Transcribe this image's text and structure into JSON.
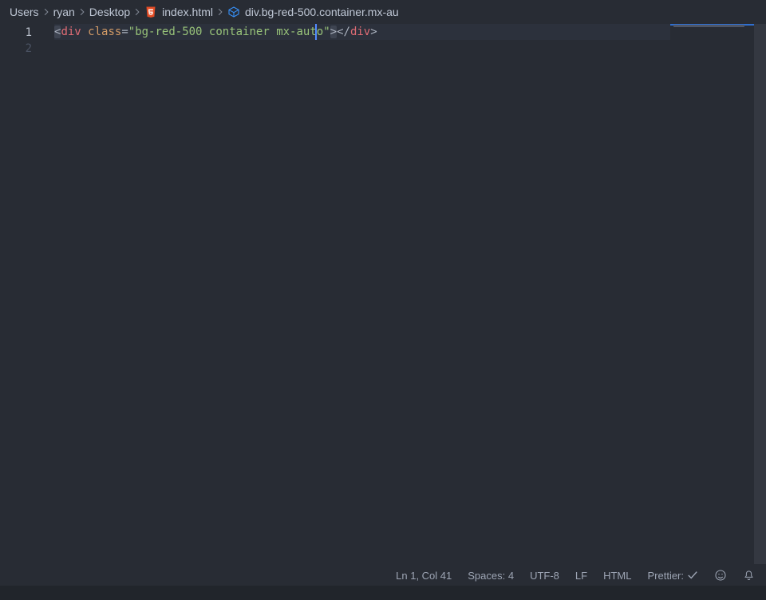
{
  "breadcrumbs": {
    "seg0": "Users",
    "seg1": "ryan",
    "seg2": "Desktop",
    "seg3": "index.html",
    "seg4": "div.bg-red-500.container.mx-au"
  },
  "gutter": {
    "l1": "1",
    "l2": "2"
  },
  "code": {
    "open_lt": "<",
    "tag": "div",
    "space1": " ",
    "attr": "class",
    "eq": "=",
    "str": "\"bg-red-500 container mx-auto\"",
    "close_gt1": ">",
    "lt_slash": "</",
    "close_gt2": ">"
  },
  "status": {
    "cursorpos": "Ln 1, Col 41",
    "spaces": "Spaces: 4",
    "encoding": "UTF-8",
    "eol": "LF",
    "lang": "HTML",
    "prettier": "Prettier:"
  }
}
